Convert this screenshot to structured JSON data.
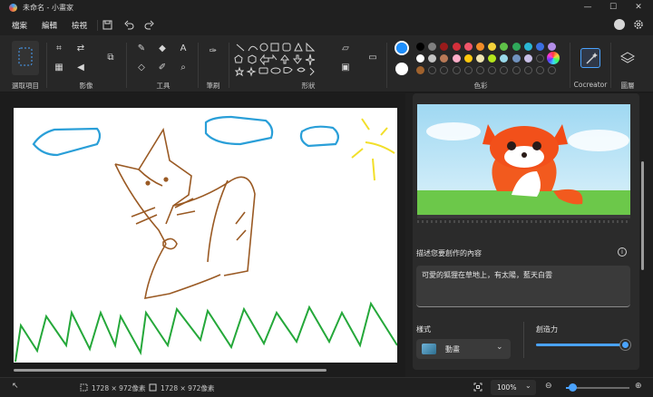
{
  "window": {
    "title": "未命名 - 小畫家",
    "minimize": "—",
    "maximize": "☐",
    "close": "✕"
  },
  "menu": {
    "file": "檔案",
    "edit": "編輯",
    "view": "檢視"
  },
  "ribbon": {
    "groups": {
      "select": "選取項目",
      "image": "影像",
      "tools": "工具",
      "brushes": "筆刷",
      "shapes": "形狀",
      "colors": "色彩",
      "cocreator": "Cocreator",
      "layers": "圖層"
    },
    "palette_row1": [
      "#000000",
      "#7f7f7f",
      "#9a1b1b",
      "#d32f3a",
      "#f0566a",
      "#f28c28",
      "#f5d33b",
      "#5fc248",
      "#2fa85a",
      "#2ab7d4",
      "#3b6fe0",
      "#b38ee8"
    ],
    "palette_row2": [
      "#ffffff",
      "#c3c3c3",
      "#b97a57",
      "#ffaec9",
      "#ffc90e",
      "#efe4b0",
      "#b5e61d",
      "#99d9ea",
      "#7092be",
      "#c8bfe7"
    ],
    "palette_row3": [
      "#a0622d"
    ],
    "primary_color": "#1e90ff",
    "secondary_color": "#ffffff"
  },
  "side_panel": {
    "prompt_label": "描述您要創作的內容",
    "prompt_text": "可愛的狐狸在草地上，有太陽，藍天白雲",
    "style_label": "樣式",
    "style_value": "動畫",
    "creativity_label": "創造力",
    "creativity_level": 0.98
  },
  "status": {
    "canvas_size": "1728 × 972像素",
    "selection_size": "1728 × 972像素",
    "zoom": "100%",
    "zoom_out": "⊖",
    "zoom_in": "⊕",
    "zoom_level": 0.1
  }
}
